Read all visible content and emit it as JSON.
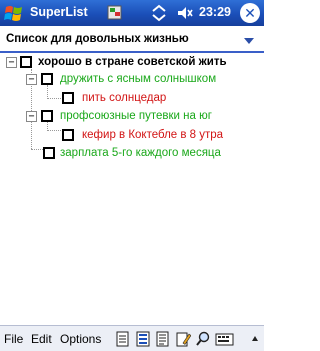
{
  "titlebar": {
    "app_title": "SuperList",
    "time": "23:29",
    "start_icon": "windows-flag-icon",
    "status_icons": [
      "connectivity-icon",
      "volume-icon"
    ]
  },
  "list_selector": {
    "selected": "Список для довольных жизнью"
  },
  "tree": {
    "items": [
      {
        "label": "хорошо в стране советской жить",
        "expander": "−"
      },
      {
        "label": "дружить с ясным солнышком",
        "expander": "−"
      },
      {
        "label": "пить солнцедар"
      },
      {
        "label": "профсоюзные путевки на юг",
        "expander": "−"
      },
      {
        "label": "кефир в Коктебле в 8 утра"
      },
      {
        "label": "зарплата 5-го каждого месяца"
      }
    ]
  },
  "menubar": {
    "file": "File",
    "edit": "Edit",
    "options": "Options"
  },
  "colors": {
    "title_bg": "#1b4fb8",
    "green_text": "#1aa81a",
    "red_text": "#d21414",
    "header_border": "#3a5fc8"
  }
}
